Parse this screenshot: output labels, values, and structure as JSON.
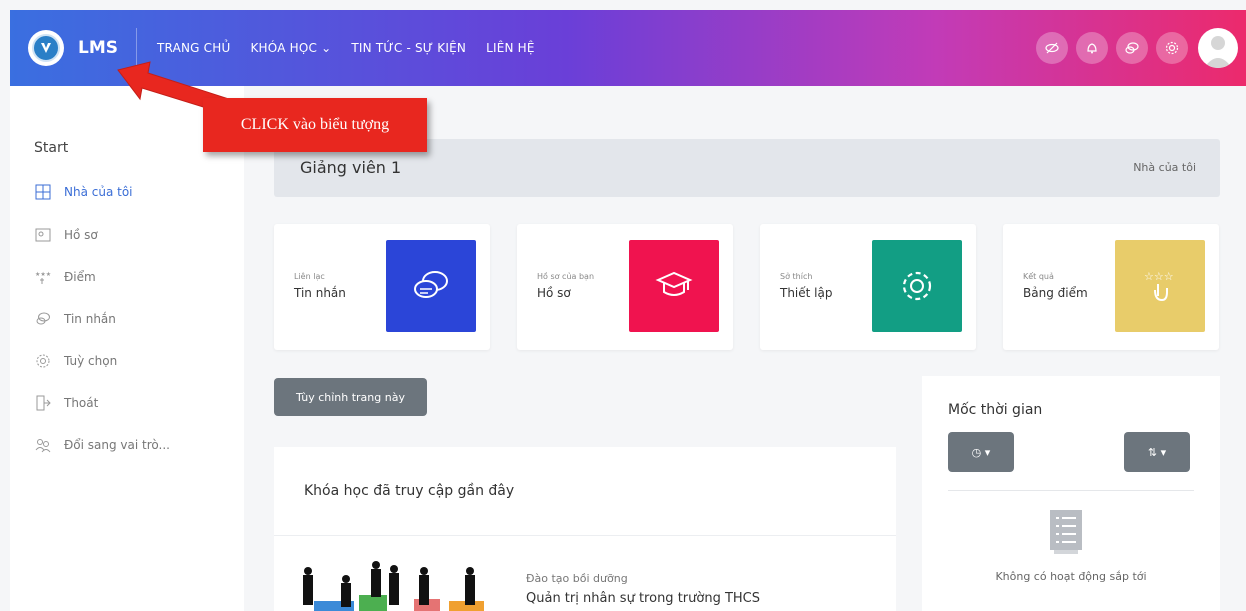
{
  "brand": {
    "name": "LMS"
  },
  "nav": {
    "home": "TRANG CHỦ",
    "courses": "KHÓA HỌC",
    "news": "TIN TỨC - SỰ KIỆN",
    "contact": "LIÊN HỆ"
  },
  "nav_icons": [
    "hide-icon",
    "bell-icon",
    "chat-icon",
    "settings-icon"
  ],
  "sidebar": {
    "title": "Start",
    "items": [
      {
        "label": "Nhà của tôi",
        "icon": "dashboard-icon"
      },
      {
        "label": "Hồ sơ",
        "icon": "profile-icon"
      },
      {
        "label": "Điểm",
        "icon": "grades-icon"
      },
      {
        "label": "Tin nhắn",
        "icon": "messages-icon"
      },
      {
        "label": "Tuỳ chọn",
        "icon": "preferences-icon"
      },
      {
        "label": "Thoát",
        "icon": "logout-icon"
      },
      {
        "label": "Đổi sang vai trò...",
        "icon": "switch-role-icon"
      }
    ]
  },
  "banner": {
    "title": "Giảng viên 1",
    "crumb": "Nhà của tôi"
  },
  "cards": [
    {
      "small": "Liên lạc",
      "big": "Tin nhắn",
      "color": "#2b45d8",
      "icon": "chat-bubbles-icon"
    },
    {
      "small": "Hồ sơ của bạn",
      "big": "Hồ sơ",
      "color": "#f0134f",
      "icon": "graduation-cap-icon"
    },
    {
      "small": "Sở thích",
      "big": "Thiết lập",
      "color": "#129e84",
      "icon": "cog-icon"
    },
    {
      "small": "Kết quả",
      "big": "Bảng điểm",
      "color": "#e8cc6a",
      "icon": "stars-hand-icon"
    }
  ],
  "customize": "Tùy chỉnh trang này",
  "recent": {
    "title": "Khóa học đã truy cập gần đây",
    "course_category": "Đào tạo bồi dưỡng",
    "course_name": "Quản trị nhân sự trong trường THCS"
  },
  "timeline": {
    "title": "Mốc thời gian",
    "empty": "Không có hoạt động sắp tới"
  },
  "callout": "CLICK vào biểu tượng"
}
